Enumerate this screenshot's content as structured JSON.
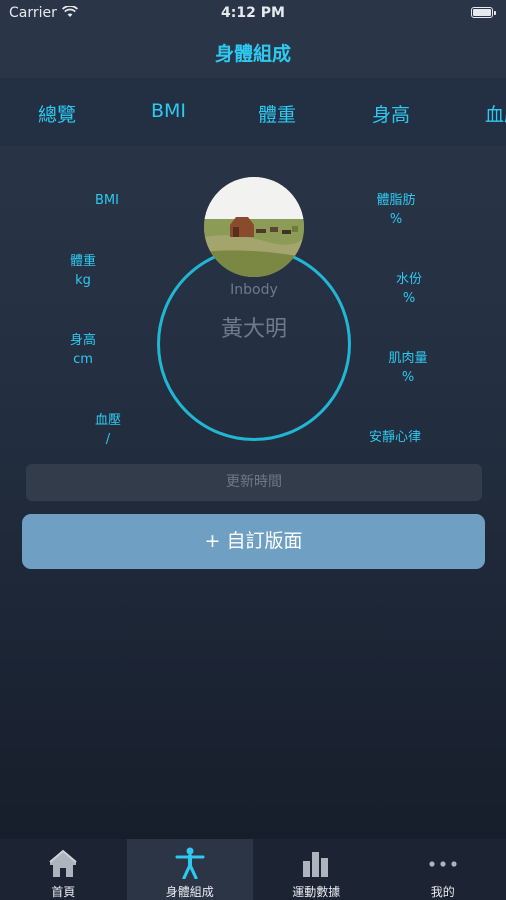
{
  "status": {
    "carrier": "Carrier",
    "time": "4:12 PM"
  },
  "nav": {
    "title": "身體組成"
  },
  "tabs": [
    {
      "label": "總覽"
    },
    {
      "label": "BMI"
    },
    {
      "label": "體重"
    },
    {
      "label": "身高"
    },
    {
      "label": "血壓"
    }
  ],
  "metrics_left": [
    {
      "label": "BMI",
      "unit": ""
    },
    {
      "label": "體重",
      "unit": "kg"
    },
    {
      "label": "身高",
      "unit": "cm"
    },
    {
      "label": "血壓",
      "unit": "/"
    }
  ],
  "metrics_right": [
    {
      "label": "體脂肪",
      "unit": "%"
    },
    {
      "label": "水份",
      "unit": "%"
    },
    {
      "label": "肌肉量",
      "unit": "%"
    },
    {
      "label": "安靜心律",
      "unit": ""
    }
  ],
  "profile": {
    "source": "Inbody",
    "name": "黃大明"
  },
  "update": {
    "label": "更新時間"
  },
  "custom_button": {
    "label": "+ 自訂版面"
  },
  "tabbar": [
    {
      "label": "首頁",
      "icon": "home-icon"
    },
    {
      "label": "身體組成",
      "icon": "body-icon",
      "active": true
    },
    {
      "label": "運動數據",
      "icon": "bar-chart-icon"
    },
    {
      "label": "我的",
      "icon": "more-icon"
    }
  ],
  "colors": {
    "accent": "#2ec9f0",
    "ring": "#21b7d4",
    "button": "#6fa0c4"
  }
}
